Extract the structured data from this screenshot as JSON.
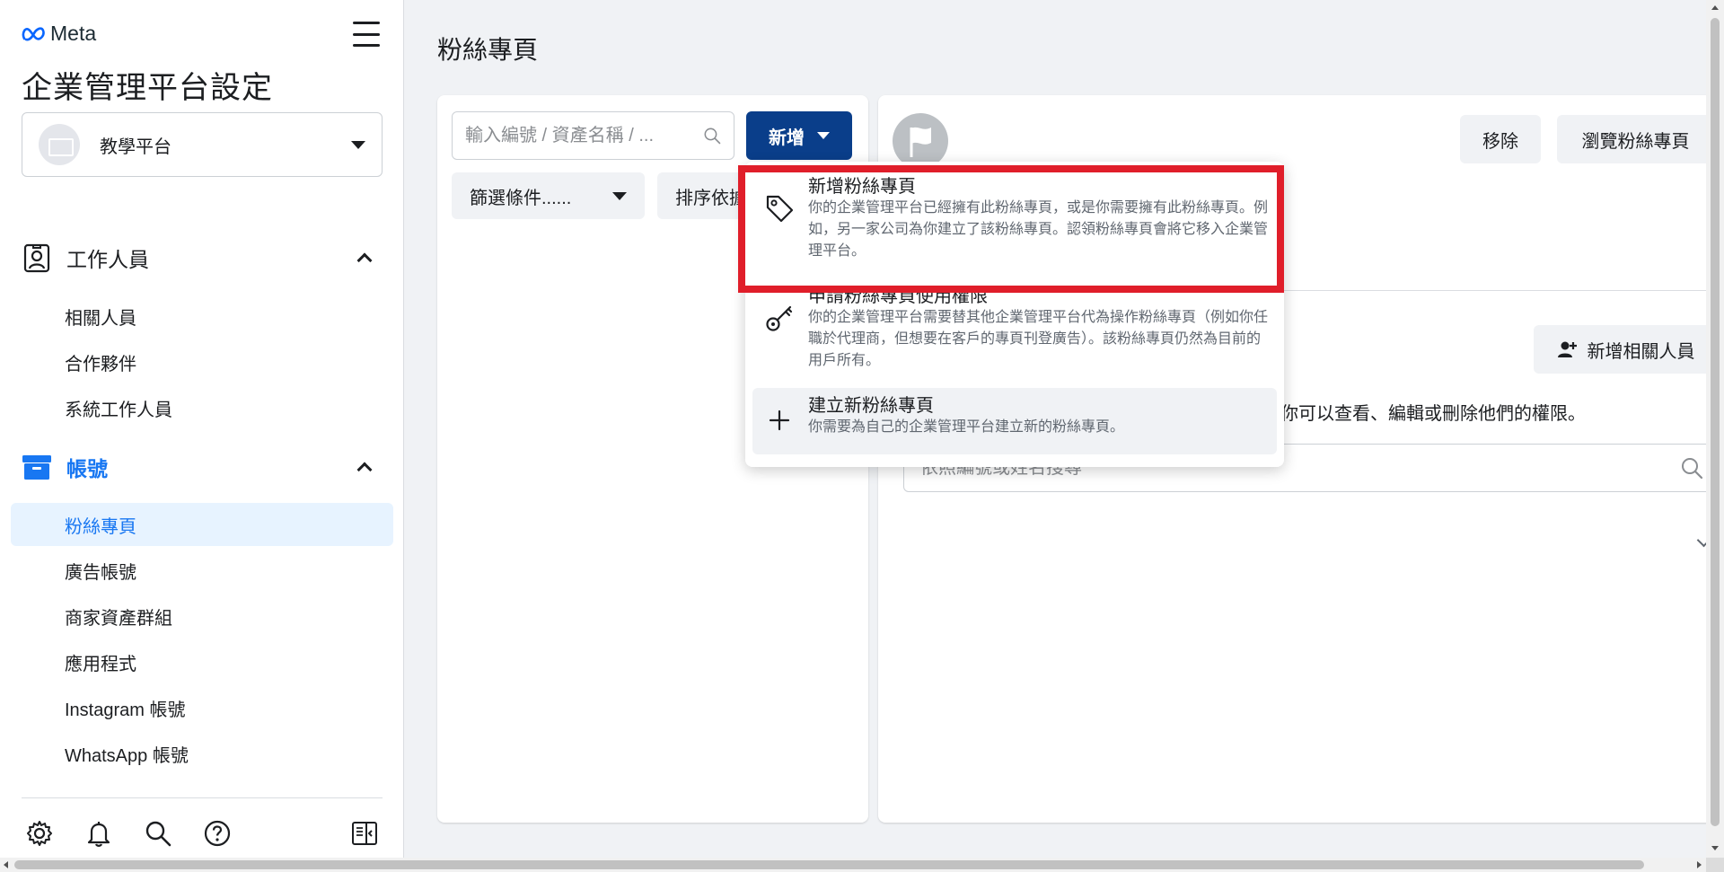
{
  "sidebar": {
    "brand": "Meta",
    "app_title": "企業管理平台設定",
    "business_name": "教學平台",
    "groups": [
      {
        "label": "工作人員",
        "items": [
          "相關人員",
          "合作夥伴",
          "系統工作人員"
        ]
      },
      {
        "label": "帳號",
        "items": [
          "粉絲專頁",
          "廣告帳號",
          "商家資產群組",
          "應用程式",
          "Instagram 帳號",
          "WhatsApp 帳號"
        ]
      }
    ],
    "selected_item": "粉絲專頁",
    "footer_icons": [
      "gear-icon",
      "bell-icon",
      "search-icon",
      "help-icon",
      "panel-toggle-icon"
    ]
  },
  "main": {
    "page_title": "粉絲專頁",
    "search_placeholder": "輸入編號 / 資產名稱 / ...",
    "add_button": "新增",
    "filter_button": "篩選條件......",
    "sort_button": "排序依據",
    "remove_button": "移除",
    "browse_button": "瀏覽粉絲專頁",
    "add_person_button": "新增相關人員",
    "people_description": "你可以查看、編輯或刪除他們的權限。",
    "people_search_placeholder": "依照編號或姓名搜尋"
  },
  "dropdown": {
    "items": [
      {
        "title": "新增粉絲專頁",
        "description": "你的企業管理平台已經擁有此粉絲專頁，或是你需要擁有此粉絲專頁。例如，另一家公司為你建立了該粉絲專頁。認領粉絲專頁會將它移入企業管理平台。",
        "icon": "tag-icon"
      },
      {
        "title": "申請粉絲專頁使用權限",
        "description": "你的企業管理平台需要替其他企業管理平台代為操作粉絲專頁（例如你任職於代理商，但想要在客戶的專頁刊登廣告）。該粉絲專頁仍然為目前的用戶所有。",
        "icon": "key-icon"
      },
      {
        "title": "建立新粉絲專頁",
        "description": "你需要為自己的企業管理平台建立新的粉絲專頁。",
        "icon": "plus-icon"
      }
    ]
  },
  "colors": {
    "accent": "#1877f2",
    "primary_button": "#0a3e8a",
    "selected_bg": "#e7f3ff",
    "highlight_border": "#e01e2a"
  }
}
